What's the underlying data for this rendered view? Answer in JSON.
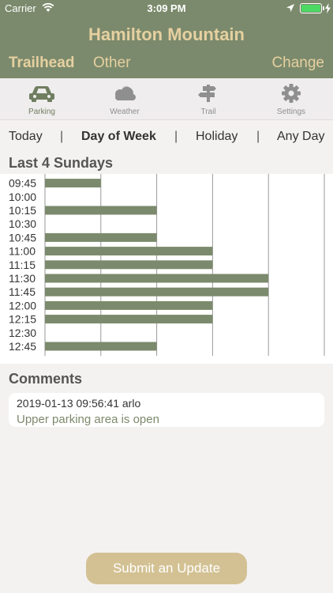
{
  "status_bar": {
    "carrier": "Carrier",
    "time": "3:09 PM"
  },
  "header": {
    "title": "Hamilton Mountain",
    "segments": [
      "Trailhead",
      "Other"
    ],
    "selected_segment": "Trailhead",
    "change_label": "Change"
  },
  "tabs": [
    {
      "label": "Parking",
      "icon": "car-icon",
      "active": true
    },
    {
      "label": "Weather",
      "icon": "cloud-icon",
      "active": false
    },
    {
      "label": "Trail",
      "icon": "trail-sign-icon",
      "active": false
    },
    {
      "label": "Settings",
      "icon": "gear-icon",
      "active": false
    }
  ],
  "day_filter": {
    "options": [
      "Today",
      "Day of Week",
      "Holiday",
      "Any Day"
    ],
    "selected": "Day of Week",
    "separator": "|"
  },
  "chart_section": {
    "title": "Last 4 Sundays"
  },
  "chart_data": {
    "type": "bar",
    "orientation": "horizontal",
    "categories": [
      "09:45",
      "10:00",
      "10:15",
      "10:30",
      "10:45",
      "11:00",
      "11:15",
      "11:30",
      "11:45",
      "12:00",
      "12:15",
      "12:30",
      "12:45"
    ],
    "values": [
      1,
      0,
      2,
      0,
      2,
      3,
      3,
      4,
      4,
      3,
      3,
      0,
      2
    ],
    "xlim": [
      0,
      5
    ],
    "grid": true,
    "bar_color": "#7b8a6c",
    "title": "",
    "xlabel": "",
    "ylabel": ""
  },
  "comments": {
    "title": "Comments",
    "items": [
      {
        "meta": "2019-01-13 09:56:41 arlo",
        "text": "Upper parking area is open"
      }
    ]
  },
  "submit_label": "Submit an Update",
  "colors": {
    "accent": "#7b8a6c",
    "header_text": "#e6d0a0",
    "button": "#d3c193"
  }
}
